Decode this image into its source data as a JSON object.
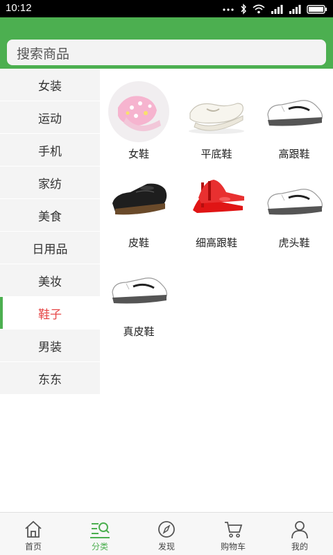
{
  "status_bar": {
    "time": "10:12",
    "icons": [
      "dots-icon",
      "bluetooth-icon",
      "wifi-icon",
      "signal-icon",
      "signal-icon",
      "battery-icon"
    ]
  },
  "search": {
    "placeholder": "搜索商品"
  },
  "sidebar": {
    "items": [
      {
        "label": "女装"
      },
      {
        "label": "运动"
      },
      {
        "label": "手机"
      },
      {
        "label": "家纺"
      },
      {
        "label": "美食"
      },
      {
        "label": "日用品"
      },
      {
        "label": "美妆"
      },
      {
        "label": "鞋子",
        "selected": true
      },
      {
        "label": "男装"
      },
      {
        "label": "东东"
      }
    ]
  },
  "products": [
    {
      "label": "女鞋",
      "icon": "baby-sandal-image"
    },
    {
      "label": "平底鞋",
      "icon": "flat-shoe-image"
    },
    {
      "label": "高跟鞋",
      "icon": "sneaker-image"
    },
    {
      "label": "皮鞋",
      "icon": "leather-shoe-image"
    },
    {
      "label": "细高跟鞋",
      "icon": "red-high-heel-image"
    },
    {
      "label": "虎头鞋",
      "icon": "sneaker-image"
    },
    {
      "label": "真皮鞋",
      "icon": "sneaker-image"
    }
  ],
  "tabbar": {
    "tabs": [
      {
        "label": "首页",
        "icon": "home-icon"
      },
      {
        "label": "分类",
        "icon": "category-search-icon",
        "active": true
      },
      {
        "label": "发现",
        "icon": "compass-icon"
      },
      {
        "label": "购物车",
        "icon": "cart-icon"
      },
      {
        "label": "我的",
        "icon": "user-icon"
      }
    ]
  },
  "colors": {
    "primary_green": "#4caf50",
    "selected_text": "#e64545",
    "sidebar_bg": "#f4f4f4"
  }
}
